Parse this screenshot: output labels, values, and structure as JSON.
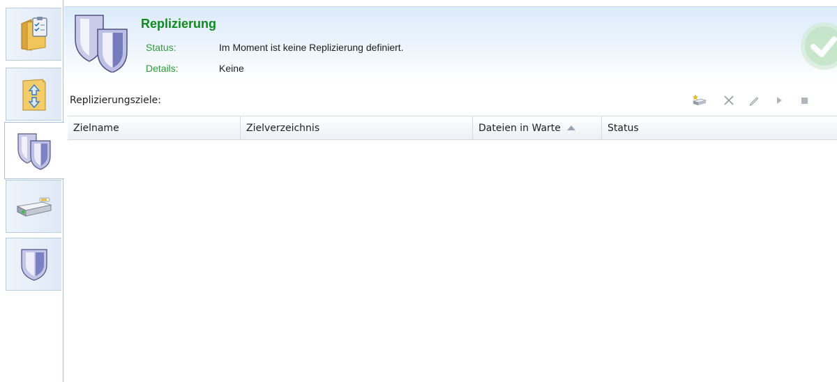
{
  "sidebar": {
    "items": [
      {
        "name": "sidebar-item-overview",
        "icon": "folder-clipboard-icon",
        "active": false
      },
      {
        "name": "sidebar-item-sync",
        "icon": "folder-arrows-icon",
        "active": false
      },
      {
        "name": "sidebar-item-replication",
        "icon": "double-shield-icon",
        "active": true
      },
      {
        "name": "sidebar-item-drive",
        "icon": "hard-drive-icon",
        "active": false
      },
      {
        "name": "sidebar-item-security",
        "icon": "shield-icon",
        "active": false
      }
    ]
  },
  "header": {
    "icon": "double-shield-icon",
    "title": "Replizierung",
    "status_label": "Status:",
    "status_value": "Im Moment ist keine Replizierung definiert.",
    "details_label": "Details:",
    "details_value": "Keine",
    "state_icon": "green-checkmark-icon"
  },
  "list": {
    "label": "Replizierungsziele:",
    "toolbar": [
      {
        "name": "add-target-button",
        "icon": "add-drive-icon",
        "enabled": true
      },
      {
        "name": "delete-button",
        "icon": "close-icon",
        "enabled": false
      },
      {
        "name": "edit-button",
        "icon": "pencil-icon",
        "enabled": false
      },
      {
        "name": "start-button",
        "icon": "play-icon",
        "enabled": false
      },
      {
        "name": "stop-button",
        "icon": "stop-icon",
        "enabled": false
      }
    ],
    "columns": [
      "Zielname",
      "Zielverzeichnis",
      "Dateien in Warte",
      "Status"
    ],
    "sorted_column": "Dateien in Warte",
    "sort_direction": "ascending",
    "rows": []
  },
  "colors": {
    "title_green": "#0f8a1f",
    "label_green": "#2e9a3a",
    "header_blue": "#dcebfa",
    "border_blue": "#a9bfd6"
  }
}
